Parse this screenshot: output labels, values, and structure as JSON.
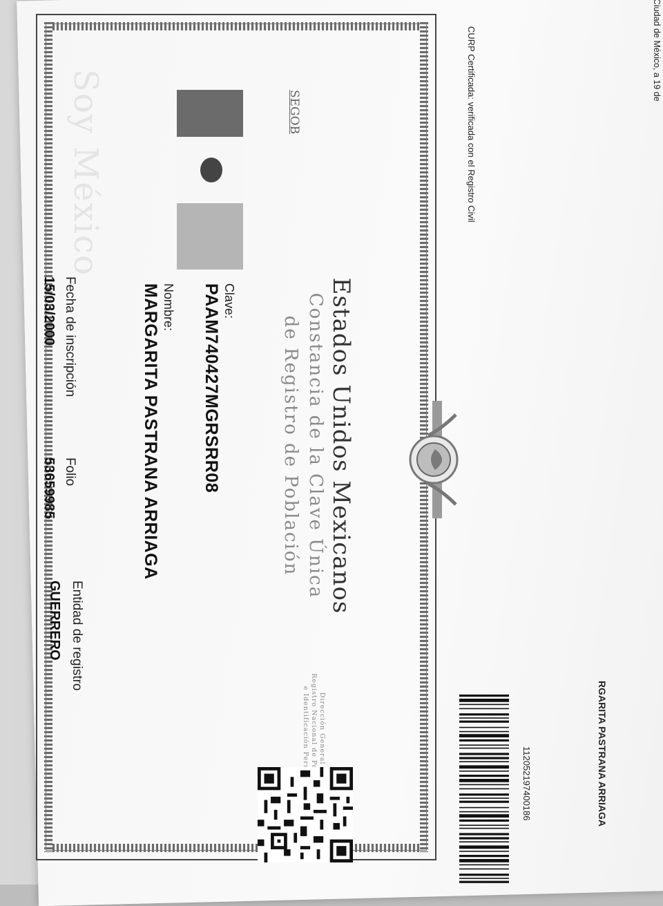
{
  "document": {
    "country": "Estados Unidos Mexicanos",
    "subtitle_line1": "Constancia de la Clave Única",
    "subtitle_line2": "de Registro de Población",
    "agency_line1": "Dirección General del",
    "agency_line2": "Registro Nacional de Población",
    "agency_line3": "e Identificación Personal",
    "segob": "SEGOB",
    "watermark": "Soy México",
    "fields": {
      "clave_label": "Clave:",
      "clave_value": "PAAM740427MGRSRR08",
      "nombre_label": "Nombre:",
      "nombre_value": "MARGARITA PASTRANA ARRIAGA",
      "fecha_label": "Fecha de inscripción",
      "fecha_value": "15/03/2000",
      "folio_label": "Folio",
      "folio_value": "53659985",
      "entidad_label": "Entidad de registro",
      "entidad_value": "GUERRERO"
    }
  },
  "below_card": {
    "curp_status": "CURP Certificada: verificada con el Registro Civil",
    "city_date": "Ciudad de México, a 19 de",
    "barcode_number": "1120521974001​86",
    "name_repeat": "RGARITA PASTRANA ARRIAGA"
  },
  "colors": {
    "paper": "#f6f6f6",
    "flag_dark": "#6b6b6b",
    "flag_light": "#b5b5b5"
  }
}
